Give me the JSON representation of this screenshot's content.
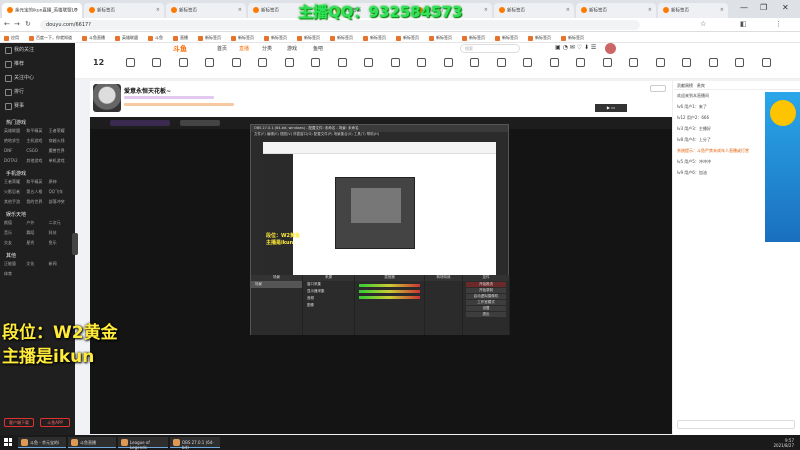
{
  "browser": {
    "tabs": [
      {
        "label": "余元宝的ikun直播_英雄联盟LO"
      },
      {
        "label": "新标签页"
      },
      {
        "label": "新标签页"
      },
      {
        "label": "新标签页"
      },
      {
        "label": "新标签页"
      },
      {
        "label": "新标签页"
      },
      {
        "label": "新标签页"
      },
      {
        "label": "新标签页"
      },
      {
        "label": "新标签页"
      }
    ],
    "url": "douyu.com/6617?",
    "window_controls": [
      "—",
      "❐",
      "✕"
    ]
  },
  "overlay": {
    "qq_text": "主播QQ：932584573",
    "rank_text": "段位：W2黄金",
    "host_text": "主播是ikun"
  },
  "bookmarks": [
    "应用",
    "百度一下，你就知道",
    "斗鱼直播",
    "英雄联盟",
    "斗鱼",
    "直播",
    "新标签页",
    "新标签页",
    "新标签页",
    "新标签页",
    "新标签页",
    "新标签页",
    "新标签页",
    "新标签页",
    "新标签页",
    "新标签页",
    "新标签页",
    "新标签页"
  ],
  "site": {
    "logo": "斗鱼",
    "nav": [
      "首页",
      "直播",
      "分类",
      "游戏",
      "鱼吧"
    ],
    "search_placeholder": "搜索",
    "cats": [
      {
        "num": "12"
      }
    ]
  },
  "sidebar": {
    "items": [
      "我的关注",
      "推荐",
      "关注中心",
      "排行",
      "赛事"
    ],
    "sections": [
      {
        "title": "热门游戏",
        "links": [
          "英雄联盟",
          "和平精英",
          "王者荣耀",
          "绝地求生",
          "主机游戏",
          "穿越火线",
          "DNF",
          "CSGO",
          "魔兽世界",
          "DOTA2",
          "其他游戏",
          "单机游戏"
        ]
      },
      {
        "title": "手机游戏",
        "links": [
          "王者荣耀",
          "和平精英",
          "原神",
          "火影忍者",
          "第五人格",
          "QQ飞车",
          "其他手游",
          "我的世界",
          "部落冲突"
        ]
      },
      {
        "title": "娱乐天地",
        "links": [
          "颜值",
          "户外",
          "二次元",
          "音乐",
          "舞蹈",
          "科技",
          "交友",
          "星秀",
          "鱼乐"
        ]
      },
      {
        "title": "其他",
        "links": [
          "正能量",
          "文化",
          "新闻",
          "体育"
        ]
      }
    ],
    "btn_left": "客户端下载",
    "btn_right": "斗鱼APP"
  },
  "room": {
    "title": "爱意永恒天花板~",
    "icons": [
      "home-icon",
      "video-icon",
      "heart-icon",
      "bag-icon",
      "trophy-icon",
      "gift-icon",
      "star-icon",
      "game-icon",
      "music-icon",
      "camera-icon",
      "chart-icon",
      "crown-icon",
      "flag-icon",
      "mic-icon",
      "book-icon",
      "shop-icon",
      "medal-icon",
      "user-icon",
      "fire-icon",
      "globe-icon",
      "bell-icon",
      "gear-icon",
      "rocket-icon",
      "grid-icon",
      "more-icon"
    ]
  },
  "obs": {
    "title": "OBS 27.0.1 (64-bit, windows) - 配置文件: 未命名 - 场景: 未命名",
    "menu": "文件(F) 编辑(E) 视图(V) 停靠窗口(D) 配置文件(P) 场景集合(S) 工具(T) 帮助(H)",
    "docks": [
      "场景",
      "来源",
      "混音器",
      "转场特效",
      "控件"
    ],
    "scene": "场景",
    "sources": [
      "窗口采集",
      "显示器采集",
      "音频",
      "图像"
    ],
    "controls": [
      "开始推流",
      "开始录制",
      "启动虚拟摄像机",
      "工作室模式",
      "设置",
      "退出"
    ]
  },
  "chat": {
    "tabs": [
      "贡献周榜",
      "贵宾"
    ],
    "messages": [
      "欢迎来到本直播间",
      "lv6 用户1：来了",
      "lv12 用户2：666",
      "lv3 用户3：主播好",
      "lv8 用户4：上分了",
      "系统提示：斗鱼严禁未成年人直播或打赏",
      "lv5 用户5：冲冲冲",
      "lv9 用户6：加油"
    ]
  },
  "taskbar": {
    "apps": [
      "斗鱼 - 余元宝的i",
      "斗鱼直播",
      "League of Legends",
      "OBS 27.0.1 (64-bit)"
    ],
    "time": "9:57",
    "date": "2021/8/27"
  }
}
